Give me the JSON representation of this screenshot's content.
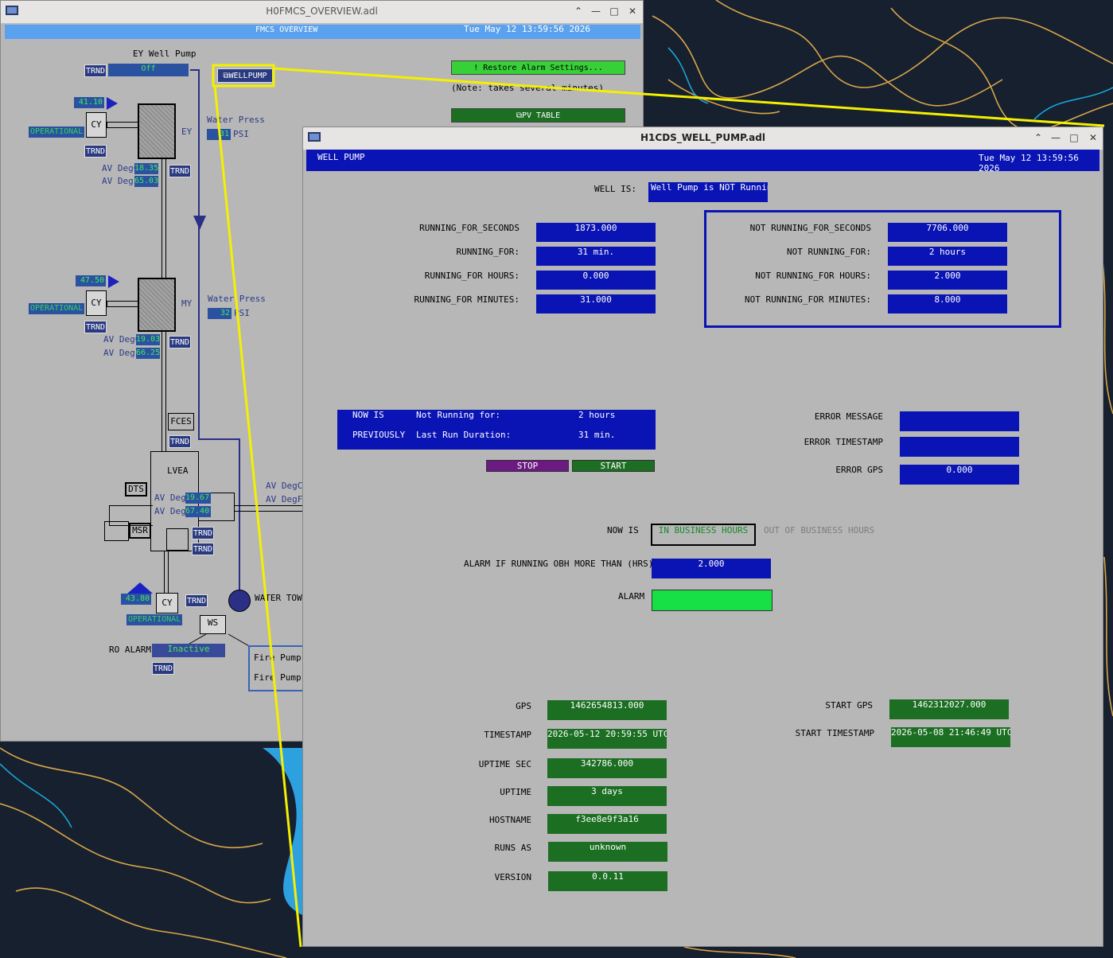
{
  "desktop": {
    "bg": "#16202e"
  },
  "overview": {
    "title": "H0FMCS_OVERVIEW.adl",
    "header": "FMCS OVERVIEW",
    "datetime": "Tue May 12 13:59:56 2026",
    "ey_well_pump_label": "EY Well Pump",
    "ey_well_pump_status": "Off",
    "wellpump_button": "WELLPUMP",
    "restore_button": "! Restore Alarm Settings...",
    "note": "(Note: takes several minutes)",
    "pv_table_button": "PV TABLE",
    "trnd": "TRND",
    "ey": {
      "temp": "41.10",
      "status": "OPERATIONAL",
      "cy": "CY",
      "name": "EY",
      "degc_label": "AV DegC",
      "degc": "18.35",
      "degf_label": "AV DegF",
      "degf": "65.03",
      "water_press_label": "Water Press",
      "water_press_value": "31",
      "psi": "PSI"
    },
    "my": {
      "temp": "47.50",
      "status": "OPERATIONAL",
      "cy": "CY",
      "name": "MY",
      "degc_label": "AV DegC",
      "degc": "19.03",
      "degf_label": "AV DegF",
      "degf": "66.25",
      "water_press_label": "Water Press",
      "water_press_value": "32",
      "psi": "PSI"
    },
    "fces": "FCES",
    "lvea": {
      "name": "LVEA",
      "degc_label": "AV DegC",
      "degc": "19.67",
      "degf_label": "AV DegF",
      "degf": "67.40",
      "degc_label_right": "AV DegC",
      "degf_label_right": "AV DegF"
    },
    "dts": "DTS",
    "msr": "MSR",
    "cs": {
      "temp": "43.80",
      "cy": "CY",
      "status": "OPERATIONAL"
    },
    "water_tower": "WATER TOWER",
    "ws": "WS",
    "ro_alarm_label": "RO ALARM",
    "ro_alarm_value": "Inactive",
    "fire_pump_1": "Fire Pump",
    "fire_pump_2": "Fire Pump"
  },
  "well_pump": {
    "title": "H1CDS_WELL_PUMP.adl",
    "header": "WELL PUMP",
    "datetime": "Tue May 12 13:59:56 2026",
    "well_is_label": "WELL IS:",
    "well_is_value": "Well Pump is NOT Running",
    "running": [
      {
        "label": "RUNNING_FOR_SECONDS",
        "value": "1873.000"
      },
      {
        "label": "RUNNING_FOR:",
        "value": "31 min."
      },
      {
        "label": "RUNNING_FOR HOURS:",
        "value": "0.000"
      },
      {
        "label": "RUNNING_FOR MINUTES:",
        "value": "31.000"
      }
    ],
    "not_running": [
      {
        "label": "NOT RUNNING_FOR_SECONDS",
        "value": "7706.000"
      },
      {
        "label": "NOT RUNNING_FOR:",
        "value": "2 hours"
      },
      {
        "label": "NOT RUNNING_FOR HOURS:",
        "value": "2.000"
      },
      {
        "label": "NOT RUNNING_FOR MINUTES:",
        "value": "8.000"
      }
    ],
    "status_panel": {
      "now_is_label": "NOW IS",
      "now_state": "Not Running for:",
      "now_value": "2 hours",
      "previously_label": "PREVIOUSLY",
      "prev_state": "Last Run Duration:",
      "prev_value": "31 min."
    },
    "stop_button": "STOP",
    "start_button": "START",
    "error_message_label": "ERROR MESSAGE",
    "error_message_value": "",
    "error_timestamp_label": "ERROR TIMESTAMP",
    "error_timestamp_value": "",
    "error_gps_label": "ERROR GPS",
    "error_gps_value": "0.000",
    "now_is_label": "NOW IS",
    "in_business_hours": "IN BUSINESS HOURS",
    "out_of_business_hours": "OUT OF BUSINESS HOURS",
    "alarm_obh_label": "ALARM IF RUNNING OBH MORE THAN (HRS)",
    "alarm_obh_value": "2.000",
    "alarm_label": "ALARM",
    "alarm_color": "#16e046",
    "info": [
      {
        "label": "GPS",
        "value": "1462654813.000"
      },
      {
        "label": "TIMESTAMP",
        "value": "2026-05-12 20:59:55 UTC"
      },
      {
        "label": "UPTIME SEC",
        "value": "342786.000"
      },
      {
        "label": "UPTIME",
        "value": "3 days"
      },
      {
        "label": "HOSTNAME",
        "value": "f3ee8e9f3a16"
      },
      {
        "label": "RUNS AS",
        "value": "unknown"
      },
      {
        "label": "VERSION",
        "value": "0.0.11"
      }
    ],
    "start_gps_label": "START GPS",
    "start_gps_value": "1462312027.000",
    "start_timestamp_label": "START TIMESTAMP",
    "start_timestamp_value": "2026-05-08 21:46:49 UTC"
  }
}
